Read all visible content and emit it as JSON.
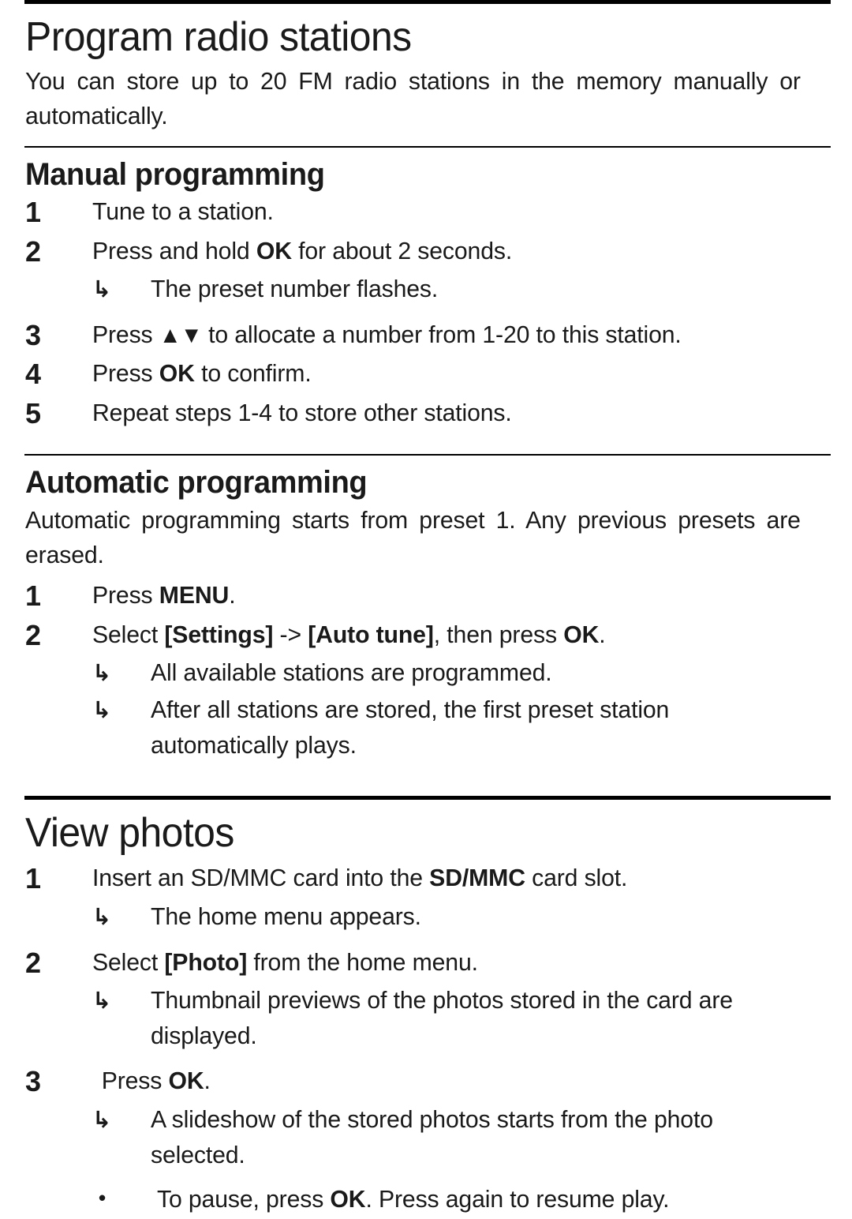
{
  "document": {
    "type": "product-manual-page",
    "sections": [
      {
        "id": "program-radio-stations",
        "divider": "thick",
        "title": "Program radio stations",
        "intro": "You can store up to 20 FM radio stations in the memory manually or automatically.",
        "subsections": [
          {
            "id": "manual-programming",
            "divider": "thin",
            "title": "Manual programming",
            "steps": [
              {
                "num": "1",
                "text": "Tune to a station."
              },
              {
                "num": "2",
                "text_before": "Press and hold ",
                "bold": "OK",
                "text_after": " for about 2 seconds."
              },
              {
                "num": "3",
                "text_before": "Press ",
                "bold": "▲▼",
                "text_after": " to allocate a number from 1-20 to this station."
              },
              {
                "num": "4",
                "text_before": "Press ",
                "bold": "OK",
                "text_after": " to confirm."
              },
              {
                "num": "5",
                "text": "Repeat steps 1-4 to store other stations."
              }
            ],
            "results": [
              {
                "after_step": "2",
                "mark": "↳",
                "text": "The preset number flashes."
              }
            ]
          },
          {
            "id": "automatic-programming",
            "divider": "thin",
            "title": "Automatic programming",
            "intro": "Automatic programming starts from preset 1. Any previous presets are erased.",
            "steps": [
              {
                "num": "1",
                "text_before": "Press ",
                "bold": "MENU",
                "text_after": "."
              },
              {
                "num": "2",
                "text_before": "Select ",
                "bold": "[Settings]",
                "mid": " -> ",
                "bold2": "[Auto tune]",
                "text_after": ", then press ",
                "bold3": "OK",
                "text_end": "."
              }
            ],
            "results": [
              {
                "mark": "↳",
                "text": "All available stations are programmed."
              },
              {
                "mark": "↳",
                "text": "After all stations are stored, the first preset station automatically plays."
              }
            ]
          }
        ]
      },
      {
        "id": "view-photos",
        "divider": "thick",
        "title": "View photos",
        "steps": [
          {
            "num": "1",
            "text_before": "Insert an SD/MMC card into the ",
            "bold": "SD/MMC",
            "text_after": " card slot."
          },
          {
            "num": "2",
            "text_before": "Select ",
            "bold": "[Photo]",
            "text_after": " from the home menu."
          },
          {
            "num": "3",
            "text_before": "Press ",
            "bold": "OK",
            "text_after": "."
          }
        ],
        "results": [
          {
            "after_step": "1",
            "mark": "↳",
            "text": "The home menu appears."
          },
          {
            "after_step": "2",
            "mark": "↳",
            "text": "Thumbnail previews of the photos stored in the card are displayed."
          },
          {
            "after_step": "3",
            "mark": "↳",
            "text": "A slideshow of the stored photos starts from the photo selected."
          },
          {
            "after_step": "3",
            "mark": "•",
            "text_before": "To pause, press ",
            "bold": "OK",
            "text_after": ". Press again to resume play."
          }
        ]
      }
    ]
  },
  "theme": {
    "page_background": "#ffffff",
    "text_color": "#1a1a1a",
    "rule_color": "#000000"
  }
}
